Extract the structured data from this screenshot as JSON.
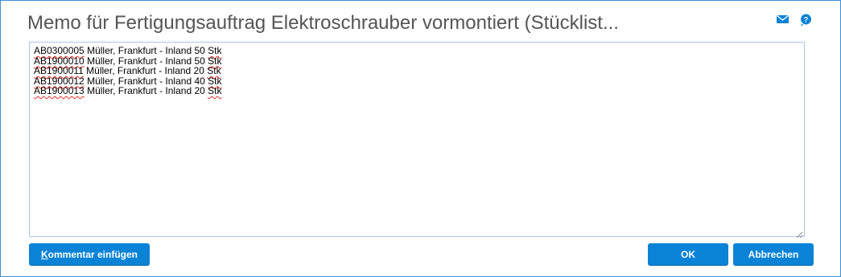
{
  "dialog": {
    "title": "Memo für Fertigungsauftrag Elektroschrauber vormontiert (Stücklist..."
  },
  "header_icons": [
    {
      "name": "mail-icon",
      "color": "#0a83d6"
    },
    {
      "name": "help-icon",
      "color": "#0a83d6"
    }
  ],
  "memo": {
    "lines": [
      {
        "code": "AB0300005",
        "text": " Müller, Frankfurt - Inland 50 ",
        "unit": "Stk"
      },
      {
        "code": "AB1900010",
        "text": " Müller, Frankfurt - Inland 50 ",
        "unit": "Stk"
      },
      {
        "code": "AB1900011",
        "text": " Müller, Frankfurt - Inland 20 ",
        "unit": "Stk"
      },
      {
        "code": "AB1900012",
        "text": " Müller, Frankfurt - Inland 40 ",
        "unit": "Stk"
      },
      {
        "code": "AB1900013",
        "text": " Müller, Frankfurt - Inland 20 ",
        "unit": "Stk"
      }
    ]
  },
  "buttons": {
    "comment_mnemonic": "K",
    "comment_rest": "ommentar einfügen",
    "ok_label": "OK",
    "cancel_label": "Abbrechen"
  },
  "colors": {
    "accent": "#0a83d6",
    "border": "#3c8fd8",
    "title_text": "#555555",
    "spellcheck": "#e0302a"
  }
}
